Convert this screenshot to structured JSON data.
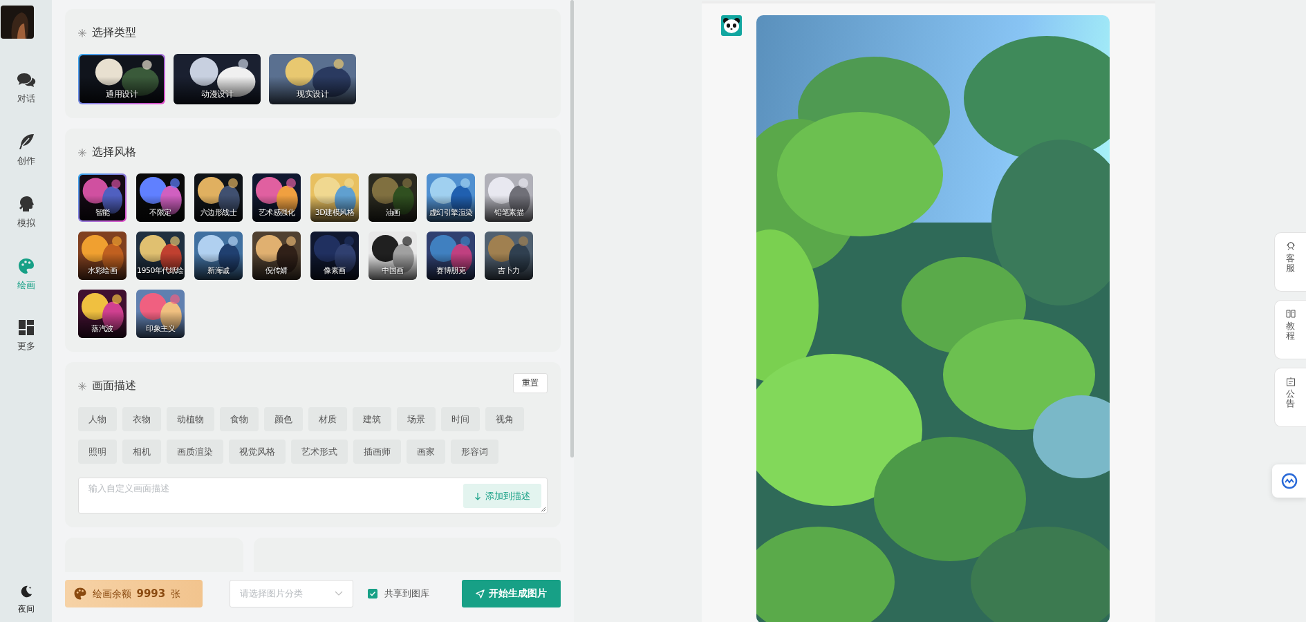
{
  "sidebar": {
    "items": [
      {
        "label": "对话",
        "selected": false
      },
      {
        "label": "创作",
        "selected": false
      },
      {
        "label": "模拟",
        "selected": false
      },
      {
        "label": "绘画",
        "selected": true
      },
      {
        "label": "更多",
        "selected": false
      }
    ],
    "night_mode": {
      "label": "夜间"
    }
  },
  "type_section": {
    "title": "选择类型",
    "options": [
      {
        "label": "通用设计",
        "selected": true
      },
      {
        "label": "动漫设计",
        "selected": false
      },
      {
        "label": "现实设计",
        "selected": false
      }
    ]
  },
  "style_section": {
    "title": "选择风格",
    "options": [
      {
        "label": "智能",
        "selected": true
      },
      {
        "label": "不限定",
        "selected": false
      },
      {
        "label": "六边形战士",
        "selected": false
      },
      {
        "label": "艺术感强化",
        "selected": false
      },
      {
        "label": "3D建模风格",
        "selected": false
      },
      {
        "label": "油画",
        "selected": false
      },
      {
        "label": "虚幻引擎渲染",
        "selected": false
      },
      {
        "label": "铅笔素描",
        "selected": false
      },
      {
        "label": "水彩绘画",
        "selected": false
      },
      {
        "label": "1950年代纸绘",
        "selected": false
      },
      {
        "label": "新海诚",
        "selected": false
      },
      {
        "label": "倪传婧",
        "selected": false
      },
      {
        "label": "像素画",
        "selected": false
      },
      {
        "label": "中国画",
        "selected": false
      },
      {
        "label": "赛博朋克",
        "selected": false
      },
      {
        "label": "吉卜力",
        "selected": false
      },
      {
        "label": "蒸汽波",
        "selected": false
      },
      {
        "label": "印象主义",
        "selected": false
      }
    ]
  },
  "description_section": {
    "title": "画面描述",
    "reset_button": "重置",
    "tags": [
      "人物",
      "衣物",
      "动植物",
      "食物",
      "颜色",
      "材质",
      "建筑",
      "场景",
      "时间",
      "视角",
      "照明",
      "相机",
      "画质渲染",
      "视觉风格",
      "艺术形式",
      "插画师",
      "画家",
      "形容词"
    ],
    "input": {
      "placeholder": "输入自定义画面描述"
    },
    "add_button": "添加到描述"
  },
  "bottom_bar": {
    "balance": "绘画余额 **9993** 张",
    "category_select": {
      "placeholder": "请选择图片分类"
    },
    "share": {
      "label": "共享到图库",
      "checked": true
    },
    "generate_button": "开始生成图片"
  },
  "side_tabs": [
    {
      "label": "客服"
    },
    {
      "label": "教程"
    },
    {
      "label": "公告"
    }
  ]
}
